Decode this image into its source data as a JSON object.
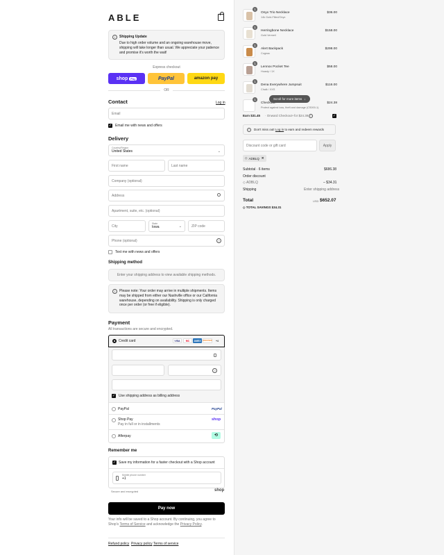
{
  "brand": "ABLE",
  "shipping_update": {
    "title": "Shipping Update",
    "body": "Due to high order volume and an ongoing warehouse move, shipping will take longer than usual. We appreciate your patience and promise it's worth the wait!"
  },
  "express": {
    "label": "Express checkout",
    "shop_pay": "shop",
    "shop_pay_badge": "Pay",
    "paypal": "PayPal",
    "amazon": "amazon pay",
    "or": "OR"
  },
  "contact": {
    "heading": "Contact",
    "login": "Log in",
    "email_placeholder": "Email",
    "news_label": "Email me with news and offers"
  },
  "delivery": {
    "heading": "Delivery",
    "country_label": "Country/Region",
    "country_value": "United States",
    "first_name": "First name",
    "last_name": "Last name",
    "company": "Company (optional)",
    "address": "Address",
    "apartment": "Apartment, suite, etc. (optional)",
    "city": "City",
    "state_label": "State",
    "state_value": "Iowa",
    "zip": "ZIP code",
    "phone": "Phone (optional)",
    "text_news": "Text me with news and offers"
  },
  "shipping_method": {
    "heading": "Shipping method",
    "placeholder": "Enter your shipping address to view available shipping methods.",
    "note": "Please note: Your order may arrive in multiple shipments. Items may be shipped from either our Nashville office or our California warehouse, depending on availability. Shipping is only charged once per order (or free if eligible)."
  },
  "payment": {
    "heading": "Payment",
    "subtext": "All transactions are secure and encrypted.",
    "credit_card": "Credit card",
    "card_logos": [
      "VISA",
      "MC",
      "AMEX",
      "DISCOVER",
      "+4"
    ],
    "billing_same": "Use shipping address as billing address",
    "paypal": "PayPal",
    "paypal_logo": "PayPal",
    "shop_pay": "Shop Pay",
    "shop_pay_sub": "Pay in full or in installments",
    "shop_pay_logo": "shop",
    "afterpay": "Afterpay",
    "afterpay_logo": "⟲"
  },
  "remember": {
    "heading": "Remember me",
    "save_label": "Save my information for a faster checkout with a Shop account",
    "phone_label": "Mobile phone number",
    "phone_value": "+1",
    "secure": "Secure and encrypted",
    "shop_logo": "shop"
  },
  "pay_now": "Pay now",
  "legal": {
    "pre": "Your info will be saved to a Shop account. By continuing, you agree to Shop's",
    "terms": "Terms of Service",
    "mid": "and acknowledge the",
    "privacy": "Privacy Policy",
    "end": "."
  },
  "footer": [
    "Refund policy",
    "Privacy policy",
    "Terms of service"
  ],
  "summary": {
    "items": [
      {
        "name": "Onyx Trio Necklace",
        "variant": "14k Gold-Filled/Onyx",
        "price": "$36.00",
        "qty": "1",
        "color": "#d9c2a8"
      },
      {
        "name": "Herringbone Necklace",
        "variant": "Gold Vermeil",
        "price": "$158.00",
        "qty": "1",
        "color": "#e8e0d2"
      },
      {
        "name": "Alert Backpack",
        "variant": "Cognac",
        "price": "$298.00",
        "qty": "1",
        "color": "#c98b4a"
      },
      {
        "name": "Lennox Pocket Tee",
        "variant": "Hoasty / 1X",
        "price": "$58.00",
        "qty": "1",
        "color": "#b8a094"
      },
      {
        "name": "Dena Everywhere Jumpsuit",
        "variant": "Chalk / XXS",
        "price": "$116.00",
        "qty": "1",
        "color": "#e2dcd2"
      },
      {
        "name": "Checkout+",
        "variant": "Protect against loss, theft and damage (CS000-1)",
        "price": "$24.38",
        "qty": "1",
        "color": "#ffffff"
      }
    ],
    "scroll_hint": "Scroll for more items",
    "earn": "Earn $31.45",
    "earn_mid": "· Onward Checkout+",
    "earn_for": "for $24.38",
    "rewards_pre": "Don't miss out!",
    "rewards_login": "Log in",
    "rewards_post": "to earn and redeem rewards",
    "discount_placeholder": "Discount code or gift card",
    "apply": "Apply",
    "code_tag": "ADBLQ",
    "subtotal_label": "Subtotal · 6 items",
    "subtotal_value": "$686.38",
    "order_discount_label": "Order discount",
    "discount_code": "ADBLQ",
    "discount_value": "– $34.31",
    "shipping_label": "Shipping",
    "shipping_value": "Enter shipping address",
    "total_label": "Total",
    "currency": "USD",
    "total_value": "$652.07",
    "savings_label": "TOTAL SAVINGS",
    "savings_value": "$34.31"
  }
}
